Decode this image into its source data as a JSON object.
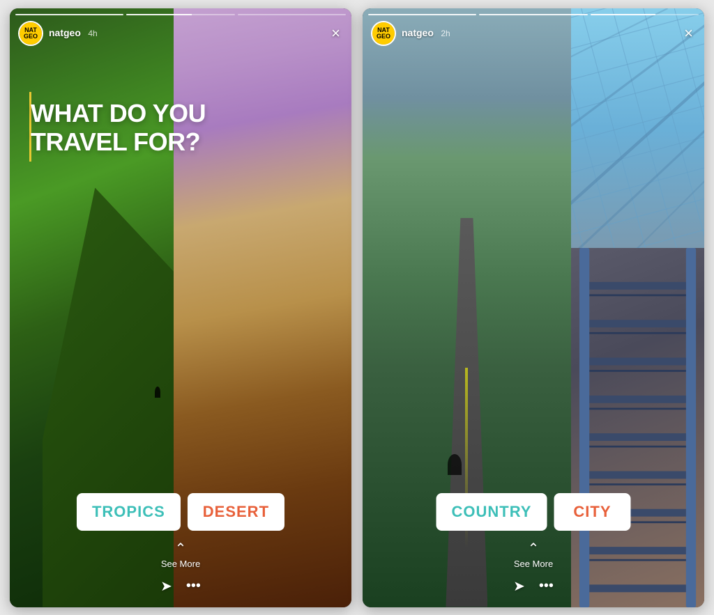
{
  "story1": {
    "username": "natgeo",
    "time_ago": "4h",
    "close_label": "×",
    "question": "WHAT DO YOU\nTRAVEL FOR?",
    "poll_option1": "TROPICS",
    "poll_option2": "DESERT",
    "see_more": "See More",
    "progress_count": 3,
    "colors": {
      "tropics": "#3dbfb8",
      "desert": "#e8603a"
    }
  },
  "story2": {
    "username": "natgeo",
    "time_ago": "2h",
    "close_label": "×",
    "poll_option1": "COUNTRY",
    "poll_option2": "CITY",
    "see_more": "See More",
    "progress_count": 3,
    "colors": {
      "country": "#3dbfb8",
      "city": "#e8603a"
    }
  },
  "icons": {
    "close": "×",
    "chevron_up": "⌃",
    "send": "▷",
    "more": "···",
    "natgeo_text": "NATIONAL\nGEOGRAPHIC"
  }
}
